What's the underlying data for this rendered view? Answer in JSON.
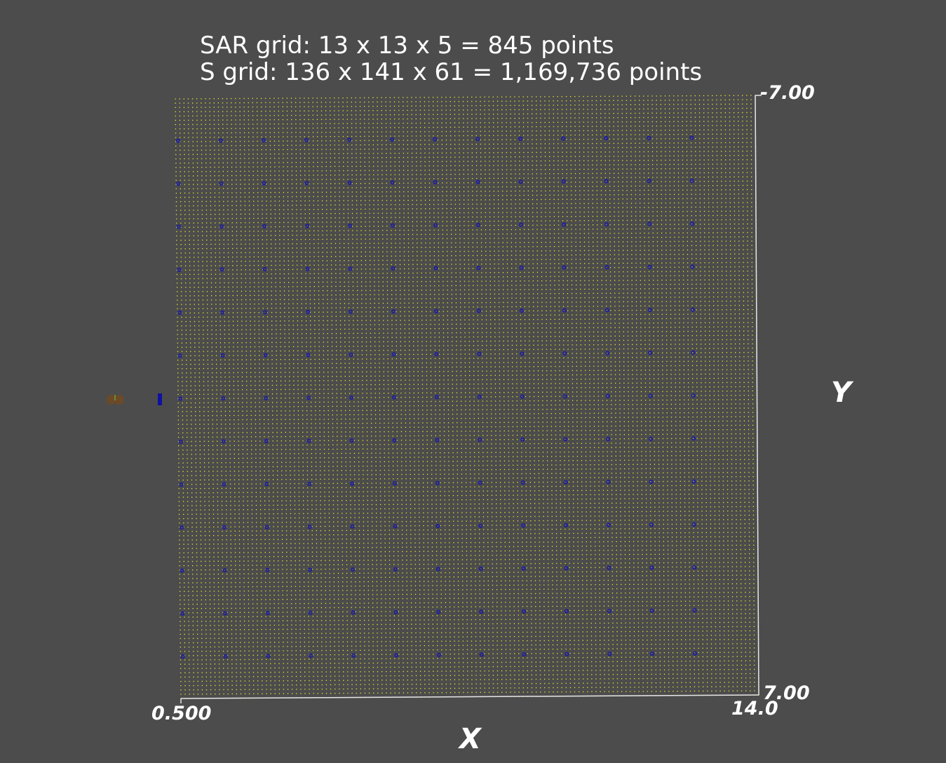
{
  "title_lines": [
    "SAR grid: 13 x 13 x 5 = 845 points",
    "S grid: 136 x 141 x 61 = 1,169,736 points"
  ],
  "axes": {
    "x": {
      "label": "X",
      "min_label": "0.500",
      "max_label": "14.0"
    },
    "y": {
      "label": "Y",
      "top_label": "-7.00",
      "bottom_label": "7.00"
    }
  },
  "colors": {
    "background": "#4c4c4c",
    "s_grid": "#e8e830",
    "sar_grid": "#1a1aa8",
    "axis_lines": "#e6e6e6",
    "text": "#ffffff"
  },
  "chart_data": {
    "type": "scatter",
    "view": "top-down 3D point cloud",
    "x_range": [
      0.5,
      14.0
    ],
    "y_range": [
      -7.0,
      7.0
    ],
    "grid": false,
    "series": [
      {
        "name": "S grid",
        "dims": [
          136,
          141,
          61
        ],
        "color": "#e8e830",
        "marker": "dot"
      },
      {
        "name": "SAR grid",
        "dims": [
          13,
          13,
          5
        ],
        "color": "#1a1aa8",
        "marker": "circle"
      }
    ]
  },
  "orientation_icon": {
    "name": "camera-orientation-icon"
  }
}
